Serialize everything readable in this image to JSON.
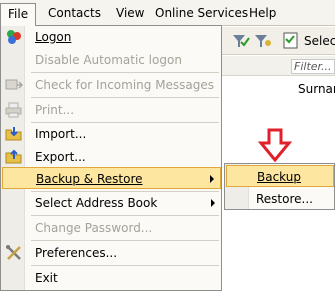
{
  "menubar": {
    "file": "File",
    "contacts": "Contacts",
    "view": "View",
    "online_services": "Online Services",
    "help": "Help"
  },
  "toolbar": {
    "select_label": "Select"
  },
  "grid": {
    "filter_placeholder": "Filter...",
    "surname_label": "Surnam"
  },
  "file_menu": {
    "items": [
      {
        "label": "Logon",
        "icon": "logon-icon",
        "enabled": true
      },
      {
        "label": "Disable Automatic logon",
        "enabled": false
      },
      {
        "label": "Check for Incoming Messages",
        "icon": "check-messages-icon",
        "enabled": false
      },
      {
        "label": "Print...",
        "icon": "printer-icon",
        "enabled": false
      },
      {
        "label": "Import...",
        "icon": "import-folder-icon",
        "enabled": true
      },
      {
        "label": "Export...",
        "icon": "export-folder-icon",
        "enabled": true
      },
      {
        "label": "Backup & Restore",
        "enabled": true,
        "submenu": true,
        "highlighted": true
      },
      {
        "label": "Select Address Book",
        "enabled": true,
        "submenu": true
      },
      {
        "label": "Change Password...",
        "enabled": false
      },
      {
        "label": "Preferences...",
        "icon": "tools-icon",
        "enabled": true
      },
      {
        "label": "Exit",
        "enabled": true
      }
    ]
  },
  "backup_submenu": {
    "items": [
      {
        "label": "Backup",
        "highlighted": true
      },
      {
        "label": "Restore..."
      }
    ]
  },
  "colors": {
    "highlight_fill": "#fde6a0",
    "highlight_border": "#e0a83b",
    "annotation_arrow": "#e0202a",
    "disabled_text": "#a5a29a"
  }
}
